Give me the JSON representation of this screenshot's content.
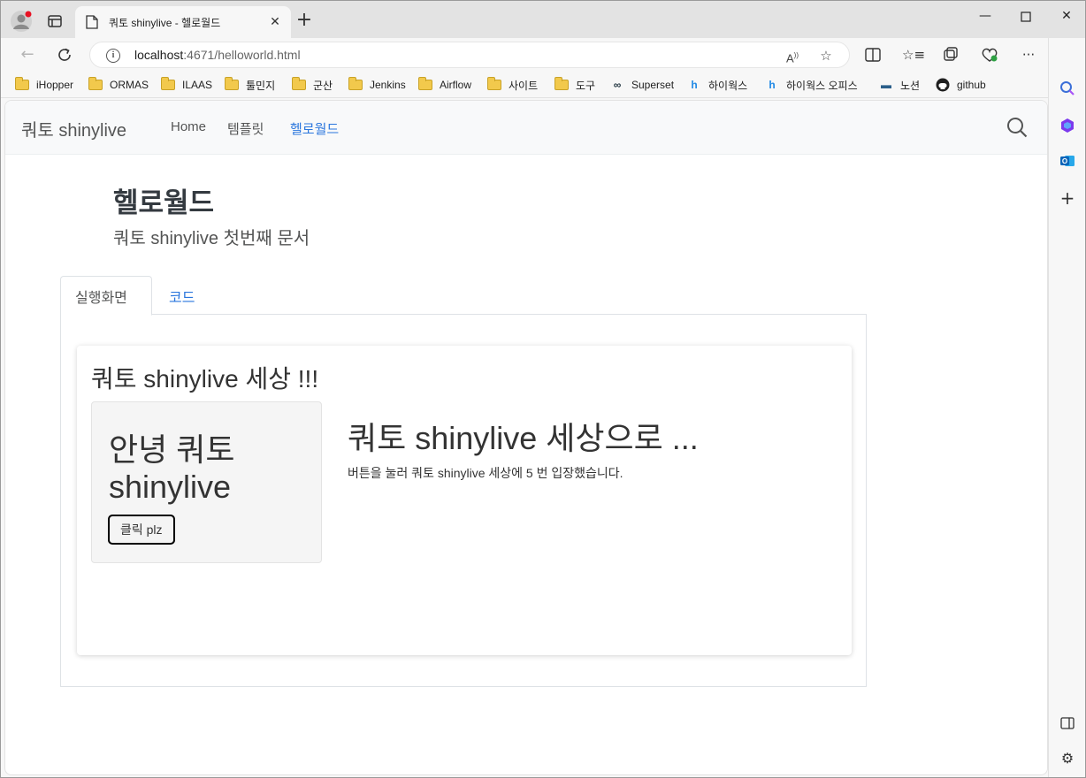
{
  "browser": {
    "tab_title": "쿼토 shinylive - 헬로월드",
    "url_host": "localhost",
    "url_path": ":4671/helloworld.html",
    "bookmarks": [
      {
        "label": "iHopper",
        "icon": "folder-icon"
      },
      {
        "label": "ORMAS",
        "icon": "folder-icon"
      },
      {
        "label": "ILAAS",
        "icon": "folder-icon"
      },
      {
        "label": "툴민지",
        "icon": "folder-icon"
      },
      {
        "label": "군산",
        "icon": "folder-icon"
      },
      {
        "label": "Jenkins",
        "icon": "folder-icon"
      },
      {
        "label": "Airflow",
        "icon": "folder-icon"
      },
      {
        "label": "사이트",
        "icon": "folder-icon"
      },
      {
        "label": "도구",
        "icon": "folder-icon"
      },
      {
        "label": "Superset",
        "icon": "infinity-icon"
      },
      {
        "label": "하이웍스",
        "icon": "hiworks-icon"
      },
      {
        "label": "하이웍스 오피스",
        "icon": "hiworks-icon"
      },
      {
        "label": "노션",
        "icon": "monitor-icon"
      },
      {
        "label": "github",
        "icon": "github-icon"
      }
    ]
  },
  "site": {
    "brand": "쿼토 shinylive",
    "nav": [
      {
        "label": "Home"
      },
      {
        "label": "템플릿"
      },
      {
        "label": "헬로월드"
      }
    ]
  },
  "page": {
    "title": "헬로월드",
    "subtitle": "쿼토 shinylive 첫번째 문서",
    "tabs": [
      {
        "label": "실행화면"
      },
      {
        "label": "코드"
      }
    ]
  },
  "app": {
    "title": "쿼토 shinylive 세상 !!!",
    "sidebar_heading": "안녕 쿼토 shinylive",
    "button_label": "클릭 plz",
    "main_heading": "쿼토 shinylive 세상으로 ...",
    "main_text": "버튼을 눌러 쿼토 shinylive 세상에 5 번 입장했습니다."
  },
  "colors": {
    "link": "#2a76dd",
    "navbar_bg": "#f8f9fa",
    "text": "#343a40"
  }
}
